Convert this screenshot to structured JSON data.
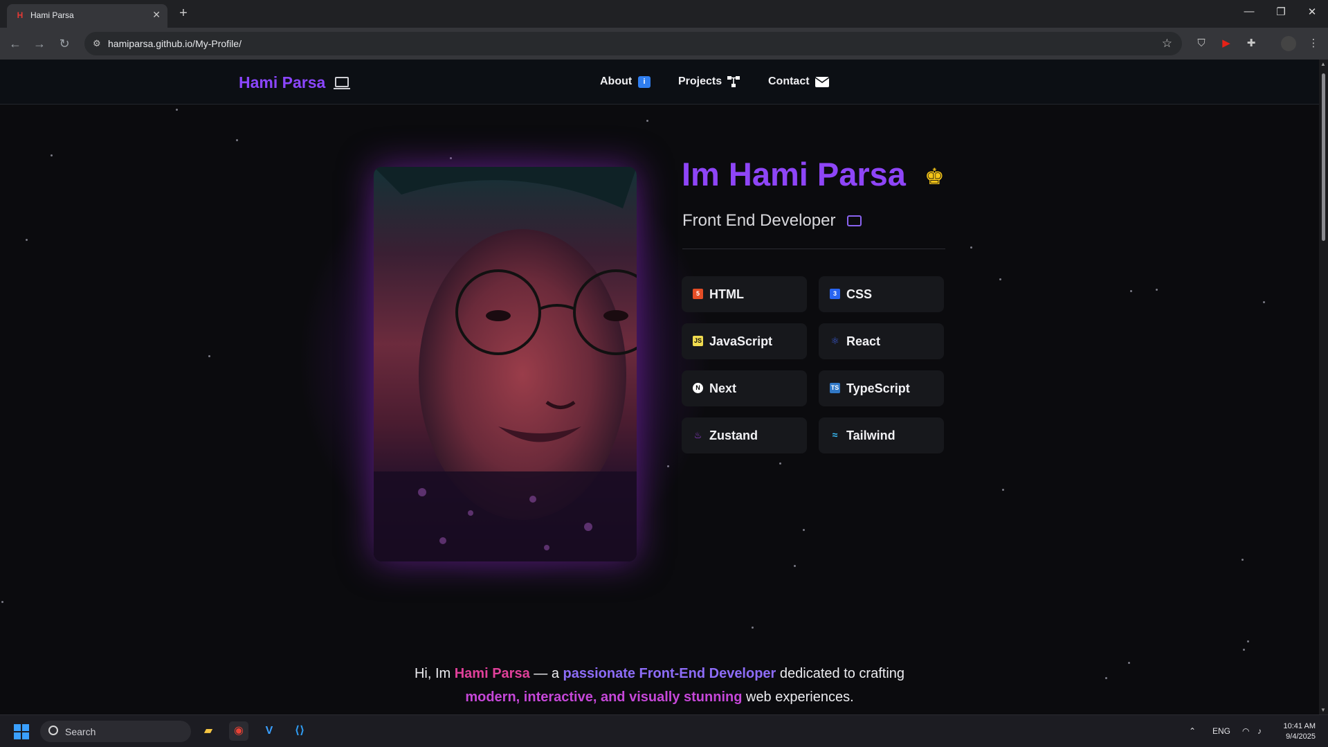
{
  "browser": {
    "tab_title": "Hami Parsa",
    "tab_favicon": "H",
    "new_tab": "+",
    "url": "hamiparsa.github.io/My-Profile/"
  },
  "site": {
    "brand": "Hami Parsa",
    "nav": [
      {
        "label": "About",
        "icon": "info-icon"
      },
      {
        "label": "Projects",
        "icon": "sitemap-icon"
      },
      {
        "label": "Contact",
        "icon": "envelope-icon"
      }
    ],
    "hero_title": "Im Hami Parsa",
    "hero_title_icon": "crown-icon",
    "subtitle": "Front End Developer",
    "skills": [
      {
        "label": "HTML",
        "icon": "html5-icon",
        "color": "#e44d26"
      },
      {
        "label": "CSS",
        "icon": "css3-icon",
        "color": "#2965f1"
      },
      {
        "label": "JavaScript",
        "icon": "js-icon",
        "color": "#f0db4f"
      },
      {
        "label": "React",
        "icon": "react-icon",
        "color": "#3b5bd6"
      },
      {
        "label": "Next",
        "icon": "next-icon",
        "color": "#ffffff"
      },
      {
        "label": "TypeScript",
        "icon": "typescript-icon",
        "color": "#3178c6"
      },
      {
        "label": "Zustand",
        "icon": "zustand-icon",
        "color": "#9b3fe0"
      },
      {
        "label": "Tailwind",
        "icon": "tailwind-icon",
        "color": "#38bdf8"
      }
    ],
    "intro": {
      "p1": "Hi, Im ",
      "name": "Hami Parsa",
      "p2": " — a ",
      "role": "passionate Front-End Developer",
      "p3": " dedicated to crafting",
      "highlight": "modern, interactive, and visually stunning",
      "p4": " web experiences."
    }
  },
  "taskbar": {
    "search_label": "Search",
    "lang": "ENG",
    "time": "10:41 AM",
    "date": "9/4/2025"
  },
  "colors": {
    "accent_purple": "#8e45f7",
    "accent_pink": "#e0409a",
    "crown_gold": "#f5c518"
  }
}
